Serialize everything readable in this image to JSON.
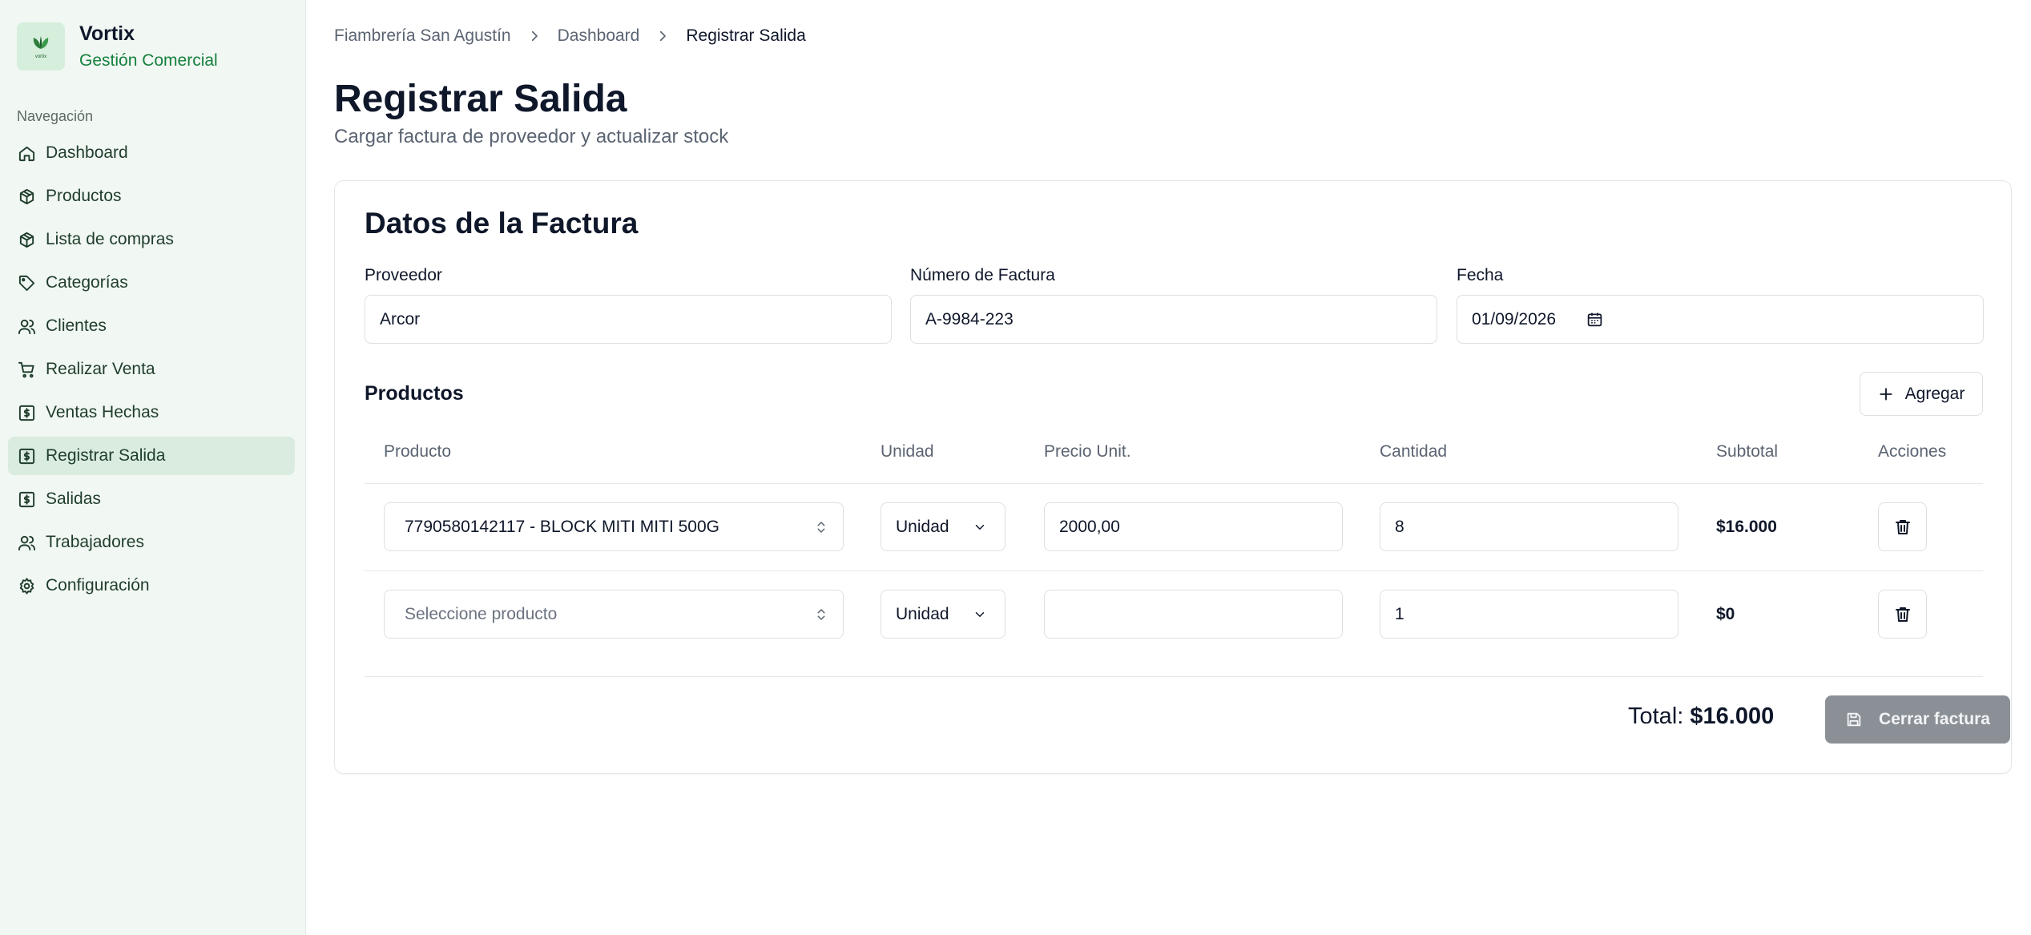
{
  "brand": {
    "name": "Vortix",
    "subtitle": "Gestión Comercial",
    "logo_text": "vortix"
  },
  "sidebar": {
    "section_label": "Navegación",
    "items": [
      {
        "label": "Dashboard",
        "icon": "home-icon"
      },
      {
        "label": "Productos",
        "icon": "package-icon"
      },
      {
        "label": "Lista de compras",
        "icon": "package-icon"
      },
      {
        "label": "Categorías",
        "icon": "tag-icon"
      },
      {
        "label": "Clientes",
        "icon": "users-icon"
      },
      {
        "label": "Realizar Venta",
        "icon": "cart-icon"
      },
      {
        "label": "Ventas Hechas",
        "icon": "receipt-icon"
      },
      {
        "label": "Registrar Salida",
        "icon": "receipt-icon",
        "active": true
      },
      {
        "label": "Salidas",
        "icon": "receipt-icon"
      },
      {
        "label": "Trabajadores",
        "icon": "users-icon"
      },
      {
        "label": "Configuración",
        "icon": "gear-icon"
      }
    ]
  },
  "breadcrumb": [
    "Fiambrería San Agustín",
    "Dashboard",
    "Registrar Salida"
  ],
  "page": {
    "title": "Registrar Salida",
    "subtitle": "Cargar factura de proveedor y actualizar stock"
  },
  "invoice": {
    "title": "Datos de la Factura",
    "supplier_label": "Proveedor",
    "supplier_value": "Arcor",
    "number_label": "Número de Factura",
    "number_value": "A-9984-223",
    "date_label": "Fecha",
    "date_value": "01/09/2026"
  },
  "products": {
    "title": "Productos",
    "add_label": "Agregar",
    "columns": [
      "Producto",
      "Unidad",
      "Precio Unit.",
      "Cantidad",
      "Subtotal",
      "Acciones"
    ],
    "rows": [
      {
        "product": "7790580142117 - BLOCK MITI MITI 500G",
        "unit": "Unidad",
        "price": "2000,00",
        "quantity": "8",
        "subtotal": "$16.000"
      },
      {
        "product": "",
        "product_placeholder": "Seleccione producto",
        "unit": "Unidad",
        "price": "",
        "quantity": "1",
        "subtotal": "$0"
      }
    ]
  },
  "footer": {
    "total_label": "Total:",
    "total_value": "$16.000",
    "close_label": "Cerrar factura"
  },
  "colors": {
    "accent": "#15803d",
    "sidebar_bg": "#f1f7f3",
    "active_bg": "#d9ecdf",
    "disabled_button": "#8b9097"
  }
}
